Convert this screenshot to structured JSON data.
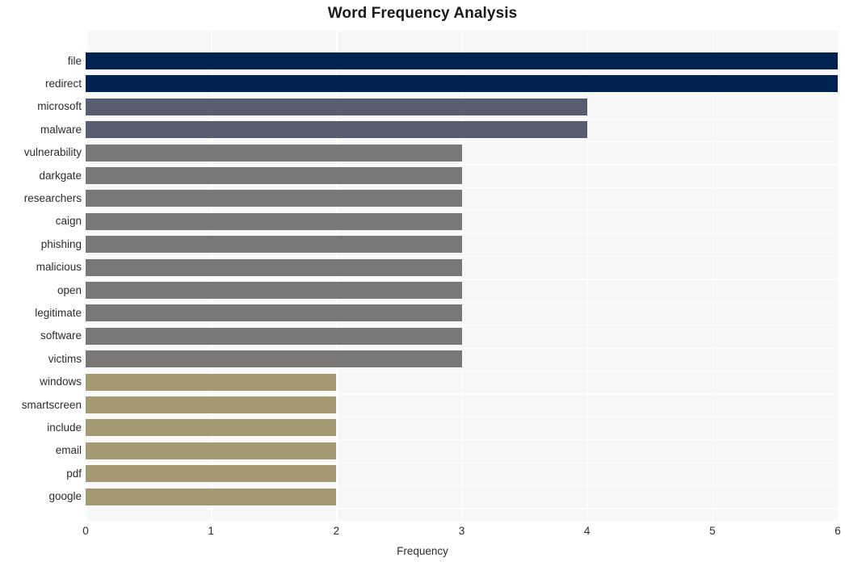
{
  "chart_data": {
    "type": "bar",
    "orientation": "horizontal",
    "title": "Word Frequency Analysis",
    "xlabel": "Frequency",
    "ylabel": "",
    "xlim": [
      0,
      6
    ],
    "xticks": [
      "0",
      "1",
      "2",
      "3",
      "4",
      "5",
      "6"
    ],
    "grid": true,
    "legend": null,
    "categories": [
      "file",
      "redirect",
      "microsoft",
      "malware",
      "vulnerability",
      "darkgate",
      "researchers",
      "caign",
      "phishing",
      "malicious",
      "open",
      "legitimate",
      "software",
      "victims",
      "windows",
      "smartscreen",
      "include",
      "email",
      "pdf",
      "google"
    ],
    "values": [
      6,
      6,
      4,
      4,
      3,
      3,
      3,
      3,
      3,
      3,
      3,
      3,
      3,
      3,
      2,
      2,
      2,
      2,
      2,
      2
    ],
    "bar_colors": [
      "#002250",
      "#002250",
      "#585d70",
      "#585d70",
      "#797876",
      "#797876",
      "#797876",
      "#797876",
      "#797876",
      "#797876",
      "#797876",
      "#797876",
      "#797876",
      "#797876",
      "#a39a73",
      "#a39a73",
      "#a39a73",
      "#a39a73",
      "#a39a73",
      "#a39a73"
    ]
  },
  "style": {
    "plot_background": "#f7f7f7",
    "figure_background": "#ffffff",
    "grid_color": "#ffffff",
    "text_color": "#2b2b2b",
    "title_color": "#1a1a1a"
  }
}
